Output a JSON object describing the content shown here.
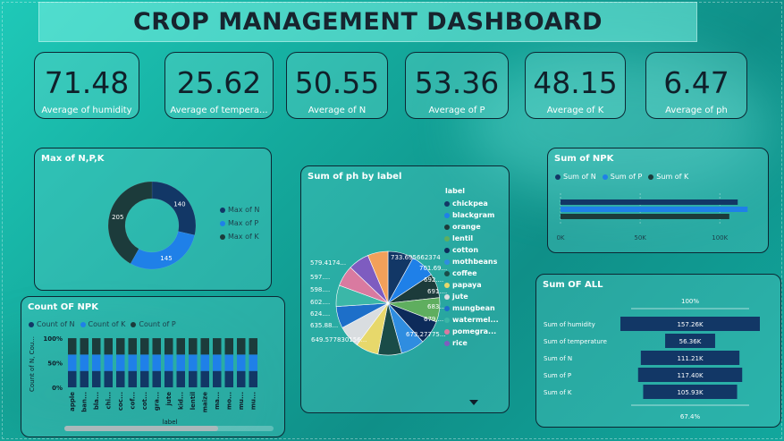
{
  "colors": {
    "n": "#123766",
    "p": "#1f80e8",
    "k": "#1c3b3b",
    "accent": "#1c8be8"
  },
  "title": "CROP MANAGEMENT DASHBOARD",
  "kpis": [
    {
      "value": "71.48",
      "label": "Average of humidity"
    },
    {
      "value": "25.62",
      "label": "Average of tempera..."
    },
    {
      "value": "50.55",
      "label": "Average of N"
    },
    {
      "value": "53.36",
      "label": "Average of P"
    },
    {
      "value": "48.15",
      "label": "Average of K"
    },
    {
      "value": "6.47",
      "label": "Average of ph"
    }
  ],
  "max_npk": {
    "title": "Max of N,P,K",
    "legend": [
      "Max of N",
      "Max of P",
      "Max of K"
    ],
    "labels": [
      "140",
      "145",
      "205"
    ]
  },
  "ph_by_label": {
    "title": "Sum of ph by label",
    "legend_title": "label",
    "legend": [
      "chickpea",
      "blackgram",
      "orange",
      "lentil",
      "cotton",
      "mothbeans",
      "coffee",
      "papaya",
      "jute",
      "mungbean",
      "watermel...",
      "pomegra...",
      "rice"
    ],
    "slice_labels": [
      "733.695662374",
      "701.69...",
      "692....",
      "691....",
      "683....",
      "679....",
      "673.27775...",
      "649.577830156...",
      "635.88...",
      "624....",
      "602....",
      "598....",
      "597....",
      "579.4174..."
    ]
  },
  "sum_npk": {
    "title": "Sum of NPK",
    "legend": [
      "Sum of N",
      "Sum of P",
      "Sum of K"
    ],
    "ticks": [
      "0K",
      "50K",
      "100K"
    ]
  },
  "count_npk": {
    "title": "Count OF NPK",
    "legend": [
      "Count of N",
      "Count of K",
      "Count of P"
    ],
    "y_label": "Count of N, Cou...",
    "y_ticks": [
      "100%",
      "50%",
      "0%"
    ],
    "x_label": "label",
    "categories": [
      "apple",
      "ban...",
      "bla...",
      "chi...",
      "coc...",
      "cof...",
      "cot...",
      "gra...",
      "jute",
      "kid...",
      "lentil",
      "maize",
      "ma...",
      "mo...",
      "mu...",
      "mu..."
    ]
  },
  "sum_all": {
    "title": "Sum OF ALL",
    "top_pct": "100%",
    "bottom_pct": "67.4%",
    "rows": [
      {
        "label": "Sum of humidity",
        "value": "157.26K"
      },
      {
        "label": "Sum of temperature",
        "value": "56.36K"
      },
      {
        "label": "Sum of N",
        "value": "111.21K"
      },
      {
        "label": "Sum of P",
        "value": "117.40K"
      },
      {
        "label": "Sum of K",
        "value": "105.93K"
      }
    ]
  },
  "chart_data": [
    {
      "type": "pie",
      "title": "Max of N,P,K",
      "categories": [
        "Max of N",
        "Max of P",
        "Max of K"
      ],
      "values": [
        140,
        145,
        205
      ]
    },
    {
      "type": "pie",
      "title": "Sum of ph by label",
      "categories": [
        "chickpea",
        "blackgram",
        "orange",
        "lentil",
        "cotton",
        "mothbeans",
        "coffee",
        "papaya",
        "jute",
        "mungbean",
        "watermel...",
        "pomegra...",
        "rice"
      ],
      "values": [
        733.7,
        701.69,
        692,
        691,
        683,
        679,
        673.28,
        649.58,
        635.88,
        624,
        602,
        598,
        597,
        579.42
      ]
    },
    {
      "type": "bar",
      "title": "Sum of NPK",
      "categories": [
        "Sum of N",
        "Sum of P",
        "Sum of K"
      ],
      "values": [
        111210,
        117400,
        105930
      ],
      "xlim": [
        0,
        120000
      ]
    },
    {
      "type": "bar",
      "title": "Count OF NPK",
      "categories": [
        "apple",
        "ban...",
        "bla...",
        "chi...",
        "coc...",
        "cof...",
        "cot...",
        "gra...",
        "jute",
        "kid...",
        "lentil",
        "maize",
        "ma...",
        "mo...",
        "mu...",
        "mu..."
      ],
      "series": [
        {
          "name": "Count of N",
          "values": [
            33.3,
            33.3,
            33.3,
            33.3,
            33.3,
            33.3,
            33.3,
            33.3,
            33.3,
            33.3,
            33.3,
            33.3,
            33.3,
            33.3,
            33.3,
            33.3
          ]
        },
        {
          "name": "Count of K",
          "values": [
            33.3,
            33.3,
            33.3,
            33.3,
            33.3,
            33.3,
            33.3,
            33.3,
            33.3,
            33.3,
            33.3,
            33.3,
            33.3,
            33.3,
            33.3,
            33.3
          ]
        },
        {
          "name": "Count of P",
          "values": [
            33.3,
            33.3,
            33.3,
            33.3,
            33.3,
            33.3,
            33.3,
            33.3,
            33.3,
            33.3,
            33.3,
            33.3,
            33.3,
            33.3,
            33.3,
            33.3
          ]
        }
      ],
      "ylim": [
        0,
        100
      ]
    },
    {
      "type": "bar",
      "title": "Sum OF ALL",
      "categories": [
        "Sum of humidity",
        "Sum of temperature",
        "Sum of N",
        "Sum of P",
        "Sum of K"
      ],
      "values": [
        157260,
        56360,
        111210,
        117400,
        105930
      ]
    }
  ]
}
